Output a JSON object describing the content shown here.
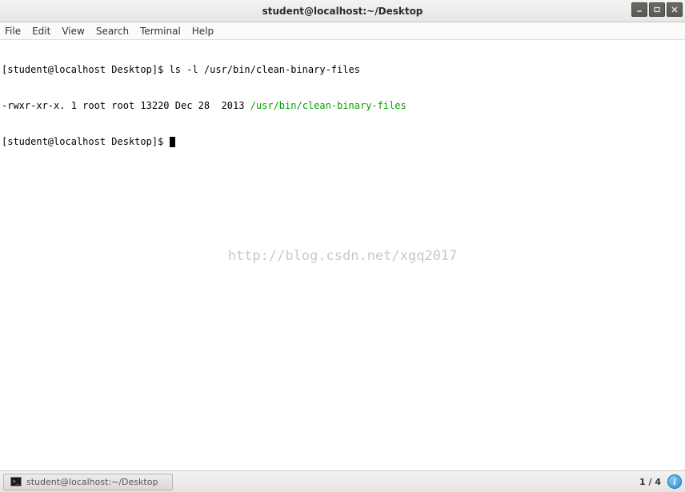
{
  "titlebar": {
    "title": "student@localhost:~/Desktop"
  },
  "menubar": {
    "file": "File",
    "edit": "Edit",
    "view": "View",
    "search": "Search",
    "terminal": "Terminal",
    "help": "Help"
  },
  "terminal": {
    "line1_prompt": "[student@localhost Desktop]$ ",
    "line1_cmd": "ls -l /usr/bin/clean-binary-files",
    "line2_plain": "-rwxr-xr-x. 1 root root 13220 Dec 28  2013 ",
    "line2_green": "/usr/bin/clean-binary-files",
    "line3_prompt": "[student@localhost Desktop]$ "
  },
  "watermark": "http://blog.csdn.net/xgq2017",
  "taskbar": {
    "active_task": "student@localhost:~/Desktop",
    "pager": "1 / 4",
    "info_glyph": "i"
  }
}
